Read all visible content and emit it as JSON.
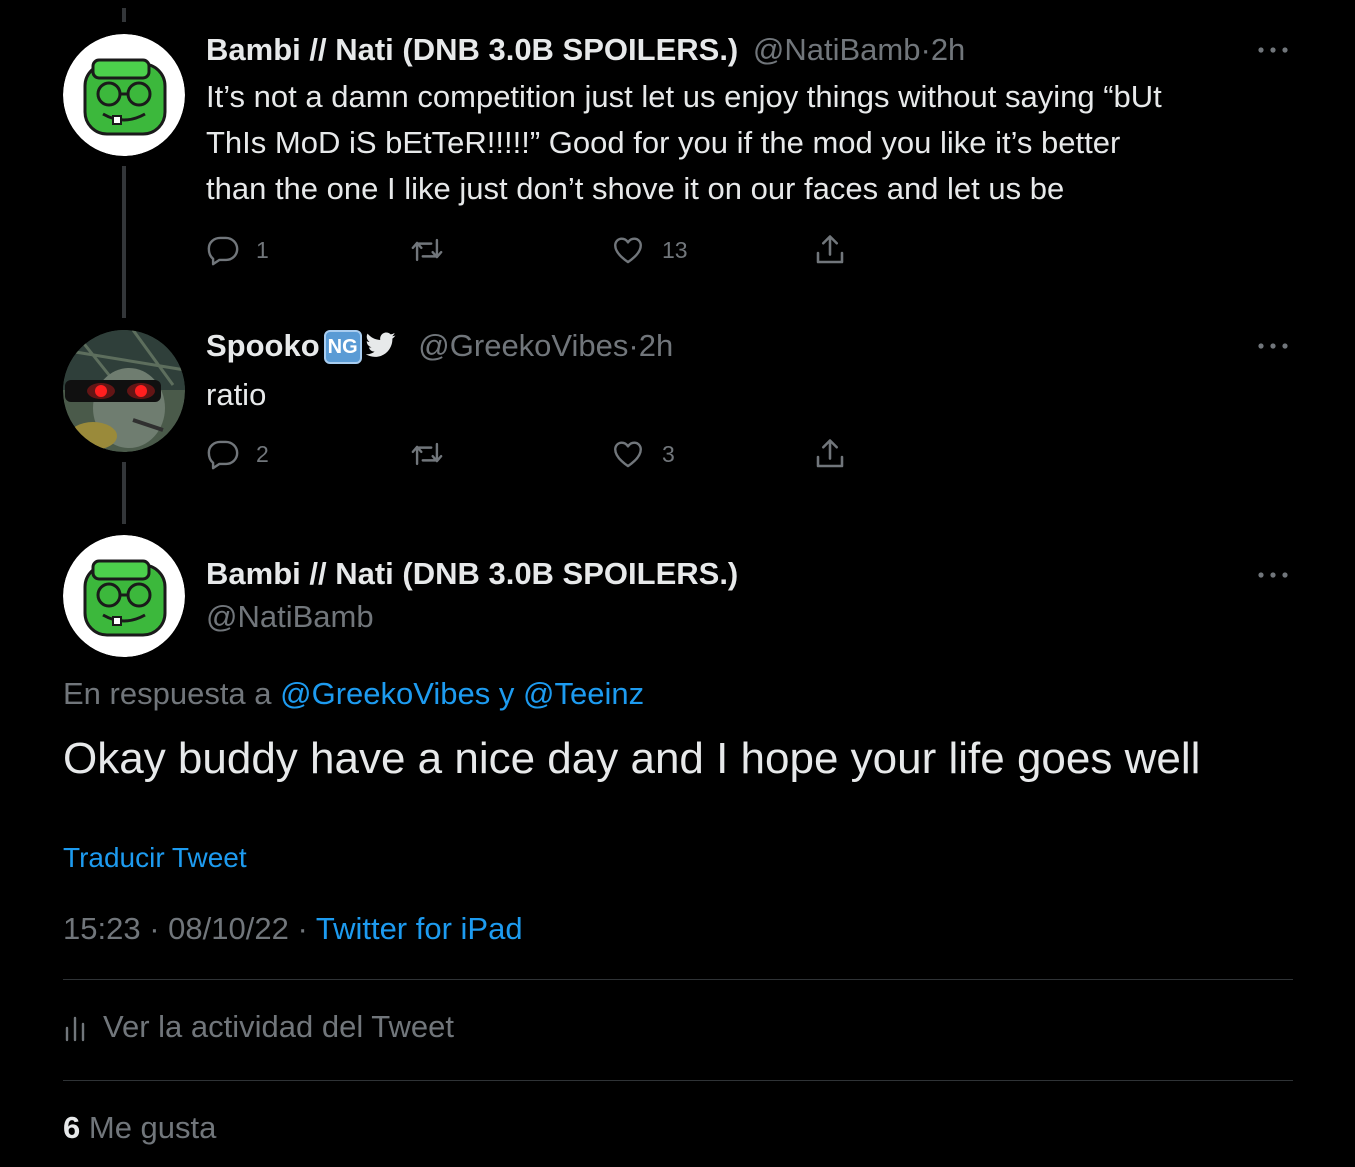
{
  "tweets": [
    {
      "name": "Bambi // Nati (DNB 3.0B SPOILERS.)",
      "handle": "@NatiBamb",
      "separator": "·",
      "time": "2h",
      "text_lines": [
        "It’s not a damn competition just let us enjoy things without saying “bUt",
        "ThIs MoD iS bEtTeR!!!!!” Good for you if the mod you like it’s better",
        "than the one I like just don’t shove it on our faces and let us be"
      ],
      "replies": "1",
      "retweets": "",
      "likes": "13"
    },
    {
      "name": "Spooko",
      "badge": "NG",
      "handle": "@GreekoVibes",
      "separator": "·",
      "time": "2h",
      "text": "ratio",
      "replies": "2",
      "retweets": "",
      "likes": "3"
    }
  ],
  "main_tweet": {
    "name": "Bambi // Nati (DNB 3.0B SPOILERS.)",
    "handle": "@NatiBamb",
    "reply_prefix": "En respuesta a",
    "reply_user1": "@GreekoVibes",
    "reply_connector": "y",
    "reply_user2": "@Teeinz",
    "text": "Okay buddy have a nice day and I hope your life goes well",
    "translate_label": "Traducir Tweet",
    "time": "15:23",
    "date": "08/10/22",
    "separator": "·",
    "source": "Twitter for iPad",
    "activity_label": "Ver la actividad del Tweet",
    "like_count": "6",
    "like_label": "Me gusta"
  },
  "icons": {
    "reply": "reply-icon",
    "retweet": "retweet-icon",
    "like": "heart-icon",
    "share": "share-icon",
    "more": "more-icon",
    "activity": "activity-icon",
    "bird": "twitter-bird-icon"
  },
  "colors": {
    "background": "#000000",
    "text": "#e7e9ea",
    "secondary": "#71767b",
    "link": "#1d9bf0",
    "avatar_green": "#3cb83c",
    "badge": "#5a9bd5"
  }
}
